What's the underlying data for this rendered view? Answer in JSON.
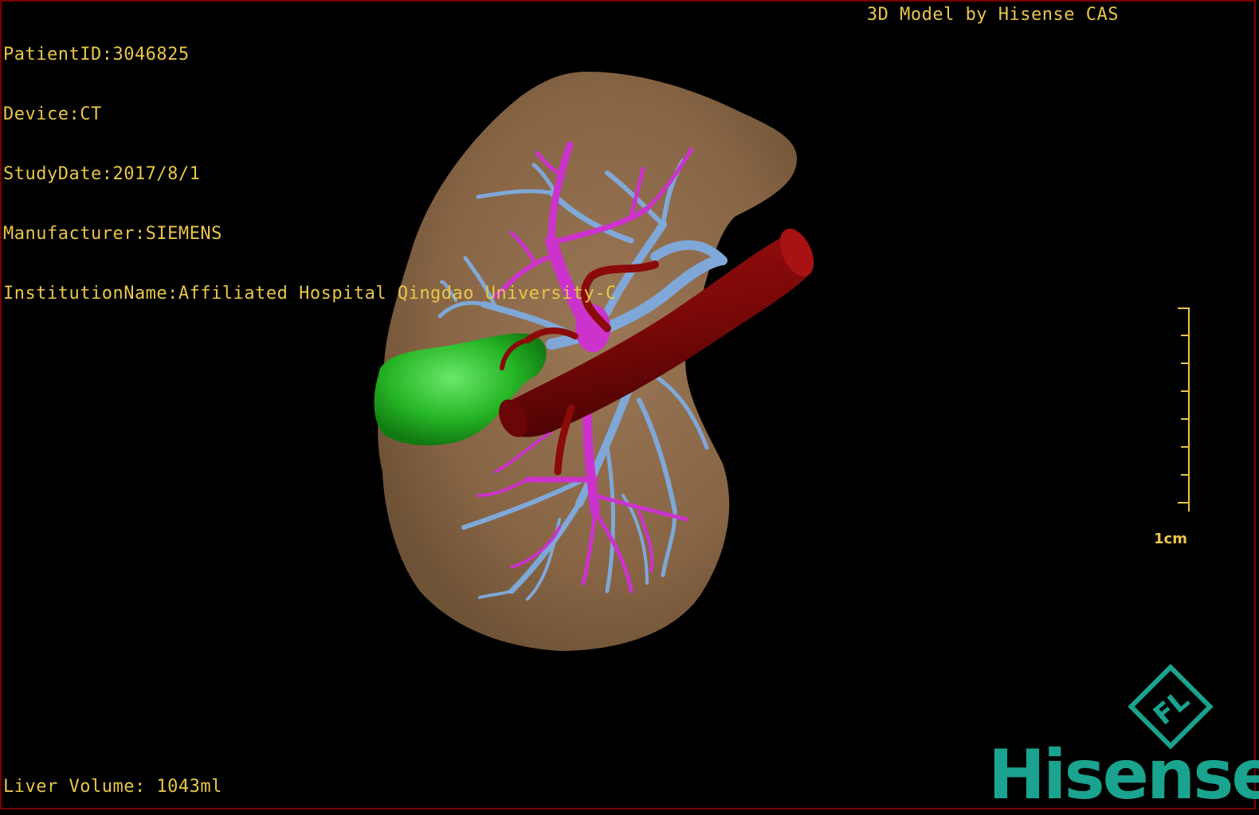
{
  "overlay": {
    "patient_id": "PatientID:3046825",
    "device": "Device:CT",
    "study_date": "StudyDate:2017/8/1",
    "manufacturer": "Manufacturer:SIEMENS",
    "institution": "InstitutionName:Affiliated Hospital Qingdao University-C",
    "model_credit": "3D Model by Hisense CAS",
    "liver_volume": "Liver Volume: 1043ml"
  },
  "scale_bar": {
    "label": "1cm",
    "color": "#e8c64a"
  },
  "logo": {
    "brand": "Hisense",
    "mark_letters": "FL",
    "color": "#1aa38f"
  },
  "colors": {
    "background": "#000000",
    "frame": "#7a0000",
    "liver": "#8a6a48",
    "portal_vein": "#7fa8d8",
    "hepatic_vein": "#cc33cc",
    "ivc": "#8b0a0a",
    "tumor": "#2fbf2f"
  }
}
